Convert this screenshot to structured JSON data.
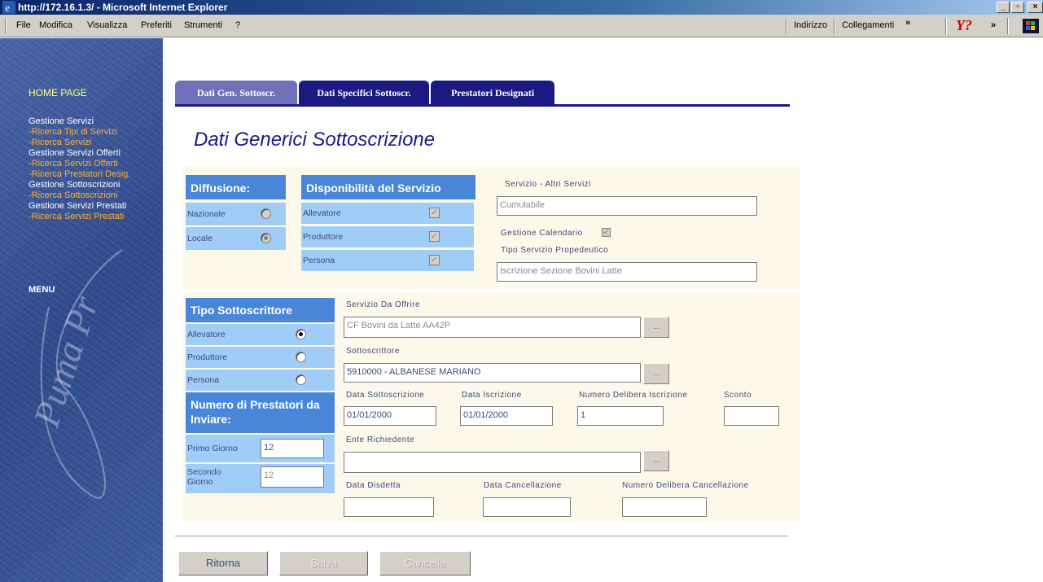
{
  "window": {
    "title": "http://172.16.1.3/ - Microsoft Internet Explorer"
  },
  "menubar": {
    "items": [
      "File",
      "Modifica",
      "Visualizza",
      "Preferiti",
      "Strumenti",
      "?"
    ],
    "address_label": "Indirizzo",
    "links_label": "Collegamenti",
    "chevron": "»"
  },
  "sidebar": {
    "home": "HOME PAGE",
    "groups": [
      {
        "title": "Gestione Servizi",
        "links": [
          "-Ricerca Tipi di Servizi",
          "-Ricerca Servizi"
        ]
      },
      {
        "title": "Gestione Servizi Offerti",
        "links": [
          "-Ricerca Servizi Offerti",
          "-Ricerca Prestatori Desig."
        ]
      },
      {
        "title": "Gestione Sottoscrizioni",
        "links": [
          "-Ricerca Sottoscrizioni"
        ]
      },
      {
        "title": "Gestione Servizi Prestati",
        "links": [
          "-Ricerca Servizi Prestati"
        ]
      }
    ],
    "menu": "MENU",
    "watermark": "Puma Pr"
  },
  "tabs": [
    "Dati Gen. Sottoscr.",
    "Dati Specifici Sottoscr.",
    "Prestatori Designati"
  ],
  "page_title": "Dati Generici Sottoscrizione",
  "diffusione": {
    "header": "Diffusione:",
    "options": [
      {
        "label": "Nazionale",
        "selected": false
      },
      {
        "label": "Locale",
        "selected": true
      }
    ]
  },
  "disponibilita": {
    "header": "Disponibilità del Servizio",
    "options": [
      {
        "label": "Allevatore",
        "checked": true
      },
      {
        "label": "Produttore",
        "checked": true
      },
      {
        "label": "Persona",
        "checked": true
      }
    ]
  },
  "servizio": {
    "label": "Servizio - Altri Servizi",
    "value": "Cumulabile",
    "calendario_label": "Gestione Calendario",
    "calendario_checked": true,
    "propedeutico_label": "Tipo Servizio Propedeutico",
    "propedeutico_value": "Iscrizione Sezione Bovini Latte"
  },
  "tipo_sottoscrittore": {
    "header": "Tipo Sottoscrittore",
    "options": [
      {
        "label": "Allevatore",
        "selected": true
      },
      {
        "label": "Produttore",
        "selected": false
      },
      {
        "label": "Persona",
        "selected": false
      }
    ]
  },
  "prestatori": {
    "header": "Numero di Prestatori da Inviare:",
    "primo_label": "Primo Giorno",
    "primo_value": "12",
    "secondo_label": "Secondo Giorno",
    "secondo_value": "12"
  },
  "form": {
    "servizio_da_offrire_label": "Servizio Da Offrire",
    "servizio_da_offrire_value": "CF Bovini da Latte AA42P",
    "sottoscrittore_label": "Sottoscrittore",
    "sottoscrittore_value": "5910000 - ALBANESE MARIANO",
    "data_sottoscrizione_label": "Data Sottoscrizione",
    "data_sottoscrizione_value": "01/01/2000",
    "data_iscrizione_label": "Data Iscrizione",
    "data_iscrizione_value": "01/01/2000",
    "numero_delibera_label": "Numero Delibera Iscrizione",
    "numero_delibera_value": "1",
    "sconto_label": "Sconto",
    "sconto_value": "",
    "ente_label": "Ente Richiedente",
    "ente_value": "",
    "data_disdetta_label": "Data Disdetta",
    "data_disdetta_value": "",
    "data_cancellazione_label": "Data Cancellazione",
    "data_cancellazione_value": "",
    "numero_delibera_canc_label": "Numero Delibera Cancellazione",
    "numero_delibera_canc_value": "",
    "browse_label": "..."
  },
  "buttons": {
    "ritorna": "Ritorna",
    "salva": "Salva",
    "cancella": "Cancella"
  },
  "colors": {
    "tab_bg": "#1a1a80",
    "tab_active_bg": "#7070b8",
    "header_blue": "#4a86d8",
    "row_blue": "#9fcdf7",
    "panel_bg": "#fcf8ea",
    "link_orange": "#ffb030"
  }
}
